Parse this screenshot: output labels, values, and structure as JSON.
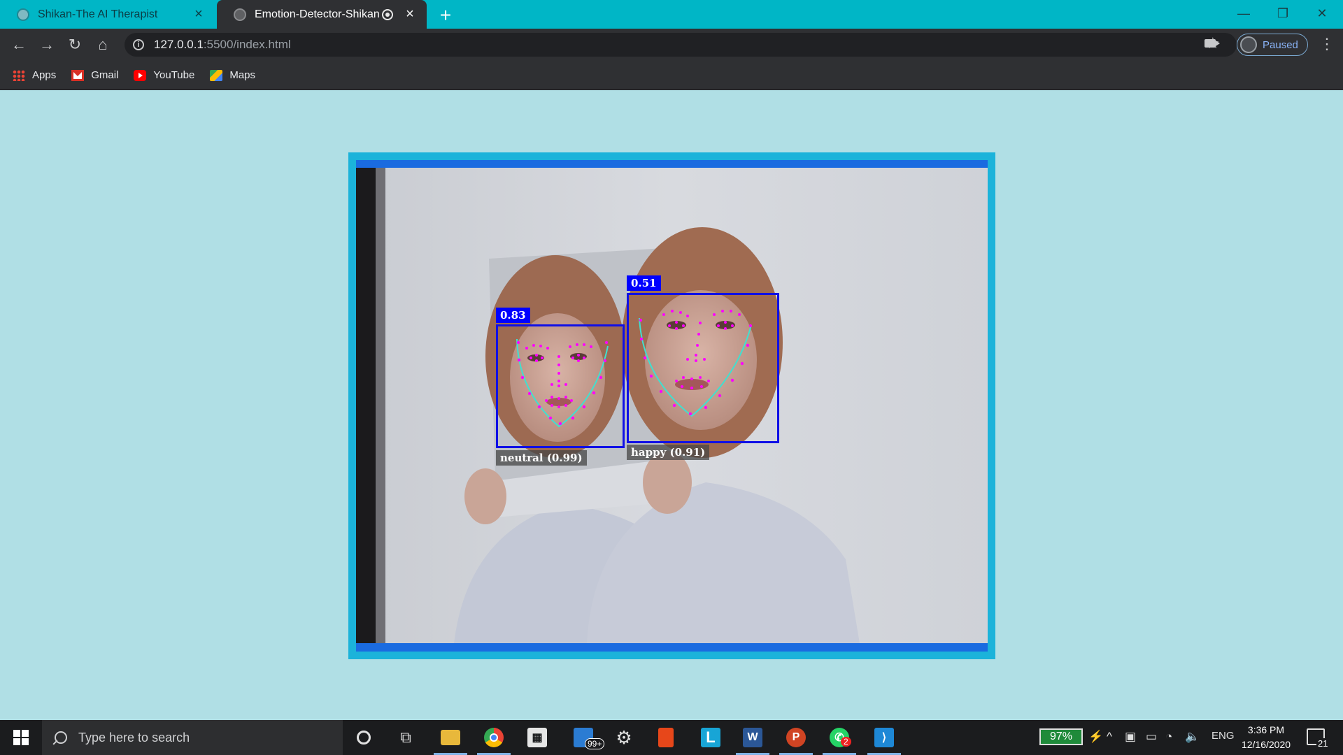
{
  "browser": {
    "tabs": [
      {
        "title": "Shikan-The AI Therapist",
        "active": false
      },
      {
        "title": "Emotion-Detector-Shikan",
        "active": true,
        "recording": true
      }
    ],
    "address": {
      "host": "127.0.0.1",
      "path": ":5500/index.html"
    },
    "profile_status": "Paused",
    "bookmarks": [
      {
        "label": "Apps",
        "icon": "apps-grid-icon"
      },
      {
        "label": "Gmail",
        "icon": "gmail-icon"
      },
      {
        "label": "YouTube",
        "icon": "youtube-icon"
      },
      {
        "label": "Maps",
        "icon": "maps-icon"
      }
    ]
  },
  "detections": [
    {
      "score": "0.83",
      "expression": "neutral (0.99)"
    },
    {
      "score": "0.51",
      "expression": "happy (0.91)"
    }
  ],
  "colors": {
    "page_background": "#b0dfe5",
    "frame_border": "#1bb3da",
    "detection_box": "#1010e6",
    "landmark_dots": "#ff00ff",
    "landmark_lines": "#40e0d0"
  },
  "taskbar": {
    "search_placeholder": "Type here to search",
    "mail_badge": "99+",
    "whatsapp_badge": "2",
    "battery": "97%",
    "language": "ENG",
    "time": "3:36 PM",
    "date": "12/16/2020",
    "notifications": "21"
  }
}
